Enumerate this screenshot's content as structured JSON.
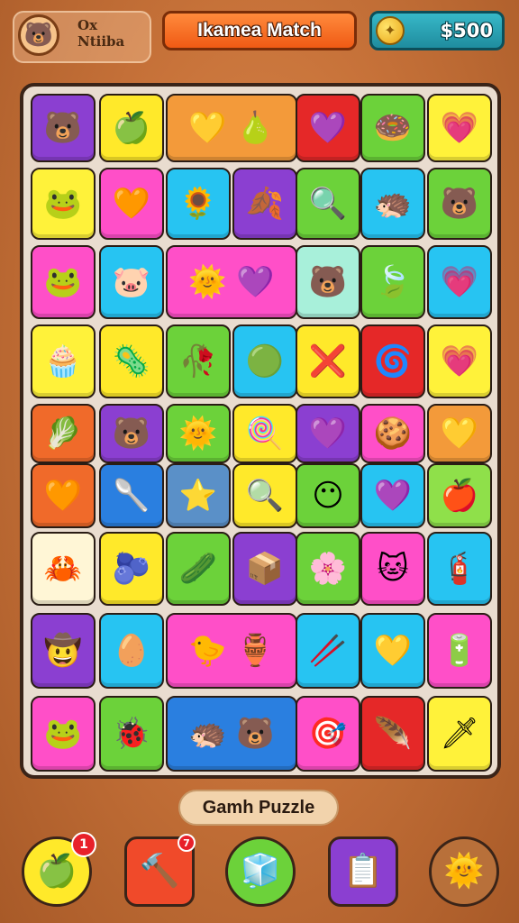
{
  "header": {
    "profile_name": "Ox\nNtiiba",
    "avatar_icon": "bear-face-icon",
    "title": "Ikamea Match",
    "coin_icon": "coin-icon",
    "coins": "$500"
  },
  "board": {
    "tiles": [
      {
        "row": 0,
        "col": 0,
        "w": 1,
        "color": "#8b3fd1",
        "icon": "🐻",
        "name": "bear-icon"
      },
      {
        "row": 0,
        "col": 1,
        "w": 1,
        "color": "#ffe92a",
        "icon": "🍏",
        "name": "apple-icon"
      },
      {
        "row": 0,
        "col": 2,
        "w": 2,
        "color": "#f39a3a",
        "icon": "💛 🍐",
        "name": "heart-pear-icon"
      },
      {
        "row": 0,
        "col": 4,
        "w": 1,
        "color": "#e52828",
        "icon": "💜",
        "name": "heart-icon"
      },
      {
        "row": 0,
        "col": 5,
        "w": 1,
        "color": "#6cd23a",
        "icon": "🍩",
        "name": "donut-icon"
      },
      {
        "row": 0,
        "col": 6,
        "w": 1,
        "color": "#fff23a",
        "icon": "💗",
        "name": "heart-icon"
      },
      {
        "row": 1,
        "col": 0,
        "w": 1,
        "color": "#fff23a",
        "icon": "🐸",
        "name": "frog-icon"
      },
      {
        "row": 1,
        "col": 1,
        "w": 1,
        "color": "#ff4fc8",
        "icon": "🧡",
        "name": "heart-icon"
      },
      {
        "row": 1,
        "col": 2,
        "w": 1,
        "color": "#27c4f2",
        "icon": "🌻",
        "name": "flower-icon"
      },
      {
        "row": 1,
        "col": 3,
        "w": 1,
        "color": "#8b3fd1",
        "icon": "🍂",
        "name": "leaf-icon"
      },
      {
        "row": 1,
        "col": 4,
        "w": 1,
        "color": "#6cd23a",
        "icon": "🔍",
        "name": "magnifier-icon"
      },
      {
        "row": 1,
        "col": 5,
        "w": 1,
        "color": "#27c4f2",
        "icon": "🦔",
        "name": "creature-icon"
      },
      {
        "row": 1,
        "col": 6,
        "w": 1,
        "color": "#6cd23a",
        "icon": "🐻",
        "name": "bear-icon"
      },
      {
        "row": 2,
        "col": 0,
        "w": 1,
        "color": "#ff4fc8",
        "icon": "🐸",
        "name": "frog-icon"
      },
      {
        "row": 2,
        "col": 1,
        "w": 1,
        "color": "#27c4f2",
        "icon": "🐷",
        "name": "pig-icon"
      },
      {
        "row": 2,
        "col": 2,
        "w": 2,
        "color": "#ff4fc8",
        "icon": "🌞 💜",
        "name": "sun-heart-icon"
      },
      {
        "row": 2,
        "col": 4,
        "w": 1,
        "color": "#a8f0da",
        "icon": "🐻",
        "name": "bear-icon"
      },
      {
        "row": 2,
        "col": 5,
        "w": 1,
        "color": "#6cd23a",
        "icon": "🍃",
        "name": "leaf-icon"
      },
      {
        "row": 2,
        "col": 6,
        "w": 1,
        "color": "#27c4f2",
        "icon": "💗",
        "name": "heart-icon"
      },
      {
        "row": 3,
        "col": 0,
        "w": 1,
        "color": "#fff23a",
        "icon": "🧁",
        "name": "box-icon"
      },
      {
        "row": 3,
        "col": 1,
        "w": 1,
        "color": "#ffe92a",
        "icon": "🦠",
        "name": "germ-icon"
      },
      {
        "row": 3,
        "col": 2,
        "w": 1,
        "color": "#6cd23a",
        "icon": "🥀",
        "name": "leaf-icon"
      },
      {
        "row": 3,
        "col": 3,
        "w": 1,
        "color": "#27c4f2",
        "icon": "🟢",
        "name": "badge-icon"
      },
      {
        "row": 3,
        "col": 4,
        "w": 1,
        "color": "#ffe92a",
        "icon": "❌",
        "name": "cross-icon"
      },
      {
        "row": 3,
        "col": 5,
        "w": 1,
        "color": "#e52828",
        "icon": "🌀",
        "name": "sun-icon"
      },
      {
        "row": 3,
        "col": 6,
        "w": 1,
        "color": "#fff23a",
        "icon": "💗",
        "name": "heart-icon"
      },
      {
        "row": 4,
        "col": 0,
        "w": 1,
        "color": "#f06a2a",
        "icon": "🥬",
        "name": "leaf-icon"
      },
      {
        "row": 4,
        "col": 1,
        "w": 1,
        "color": "#8b3fd1",
        "icon": "🐻",
        "name": "bear-icon"
      },
      {
        "row": 4,
        "col": 2,
        "w": 1,
        "color": "#6cd23a",
        "icon": "🌞",
        "name": "sun-icon"
      },
      {
        "row": 4,
        "col": 3,
        "w": 1,
        "color": "#ffe92a",
        "icon": "🍭",
        "name": "candy-icon"
      },
      {
        "row": 4,
        "col": 4,
        "w": 1,
        "color": "#8b3fd1",
        "icon": "💜",
        "name": "heart-icon"
      },
      {
        "row": 4,
        "col": 5,
        "w": 1,
        "color": "#ff4fc8",
        "icon": "🍪",
        "name": "cookie-icon"
      },
      {
        "row": 4,
        "col": 6,
        "w": 1,
        "color": "#f39a3a",
        "icon": "💛",
        "name": "heart-icon"
      },
      {
        "row": 5,
        "col": 0,
        "w": 1,
        "color": "#f06a2a",
        "icon": "🧡",
        "name": "heart-icon"
      },
      {
        "row": 5,
        "col": 1,
        "w": 1,
        "color": "#2a7fe0",
        "icon": "🥄",
        "name": "spoon-icon"
      },
      {
        "row": 5,
        "col": 2,
        "w": 1,
        "color": "#5a90c8",
        "icon": "⭐",
        "name": "star-icon"
      },
      {
        "row": 5,
        "col": 3,
        "w": 1,
        "color": "#ffe92a",
        "icon": "🔍",
        "name": "magnifier-icon"
      },
      {
        "row": 5,
        "col": 4,
        "w": 1,
        "color": "#6cd23a",
        "icon": "😶",
        "name": "block-face-icon"
      },
      {
        "row": 5,
        "col": 5,
        "w": 1,
        "color": "#27c4f2",
        "icon": "💜",
        "name": "heart-icon"
      },
      {
        "row": 5,
        "col": 6,
        "w": 1,
        "color": "#8fe04a",
        "icon": "🍎",
        "name": "apple-icon"
      },
      {
        "row": 6,
        "col": 0,
        "w": 1,
        "color": "#fff6d6",
        "icon": "🦀",
        "name": "crab-icon"
      },
      {
        "row": 6,
        "col": 1,
        "w": 1,
        "color": "#ffe92a",
        "icon": "🫐",
        "name": "blob-icon"
      },
      {
        "row": 6,
        "col": 2,
        "w": 1,
        "color": "#6cd23a",
        "icon": "🥒",
        "name": "cucumber-icon"
      },
      {
        "row": 6,
        "col": 3,
        "w": 1,
        "color": "#8b3fd1",
        "icon": "📦",
        "name": "box-icon"
      },
      {
        "row": 6,
        "col": 4,
        "w": 1,
        "color": "#6cd23a",
        "icon": "🌸",
        "name": "flower-icon"
      },
      {
        "row": 6,
        "col": 5,
        "w": 1,
        "color": "#ff4fc8",
        "icon": "🐱",
        "name": "cat-icon"
      },
      {
        "row": 6,
        "col": 6,
        "w": 1,
        "color": "#27c4f2",
        "icon": "🧯",
        "name": "hydrant-icon"
      },
      {
        "row": 7,
        "col": 0,
        "w": 1,
        "color": "#8b3fd1",
        "icon": "🤠",
        "name": "face-icon"
      },
      {
        "row": 7,
        "col": 1,
        "w": 1,
        "color": "#27c4f2",
        "icon": "🥚",
        "name": "egg-icon"
      },
      {
        "row": 7,
        "col": 2,
        "w": 2,
        "color": "#ff4fc8",
        "icon": "🐤 🏺",
        "name": "chick-vase-icon"
      },
      {
        "row": 7,
        "col": 4,
        "w": 1,
        "color": "#27c4f2",
        "icon": "🥢",
        "name": "chopsticks-icon"
      },
      {
        "row": 7,
        "col": 5,
        "w": 1,
        "color": "#27c4f2",
        "icon": "💛",
        "name": "heart-icon"
      },
      {
        "row": 7,
        "col": 6,
        "w": 1,
        "color": "#ff4fc8",
        "icon": "🔋",
        "name": "battery-icon"
      },
      {
        "row": 8,
        "col": 0,
        "w": 1,
        "color": "#ff4fc8",
        "icon": "🐸",
        "name": "frog-icon"
      },
      {
        "row": 8,
        "col": 1,
        "w": 1,
        "color": "#6cd23a",
        "icon": "🐞",
        "name": "bug-icon"
      },
      {
        "row": 8,
        "col": 2,
        "w": 2,
        "color": "#2a7fe0",
        "icon": "🦔 🐻",
        "name": "creature-bear-icon"
      },
      {
        "row": 8,
        "col": 4,
        "w": 1,
        "color": "#ff4fc8",
        "icon": "🎯",
        "name": "target-icon"
      },
      {
        "row": 8,
        "col": 5,
        "w": 1,
        "color": "#e52828",
        "icon": "🪶",
        "name": "feather-icon"
      },
      {
        "row": 8,
        "col": 6,
        "w": 1,
        "color": "#fff23a",
        "icon": "🗡",
        "name": "sword-icon"
      }
    ]
  },
  "footer": {
    "label": "Gamh Puzzle",
    "buttons": [
      {
        "name": "powerup-apple-button",
        "icon": "🍏",
        "color": "#ffe92a",
        "shape": "round",
        "badge": "1"
      },
      {
        "name": "powerup-hammer-button",
        "icon": "🔨",
        "color": "#f04a2a",
        "shape": "square",
        "badge": "7"
      },
      {
        "name": "powerup-shuffle-button",
        "icon": "🧊",
        "color": "#6cd23a",
        "shape": "round",
        "badge": ""
      },
      {
        "name": "powerup-clipboard-button",
        "icon": "📋",
        "color": "#8b3fd1",
        "shape": "square",
        "badge": ""
      },
      {
        "name": "powerup-sun-button",
        "icon": "🌞",
        "color": "#b8703a",
        "shape": "round",
        "badge": ""
      }
    ]
  }
}
